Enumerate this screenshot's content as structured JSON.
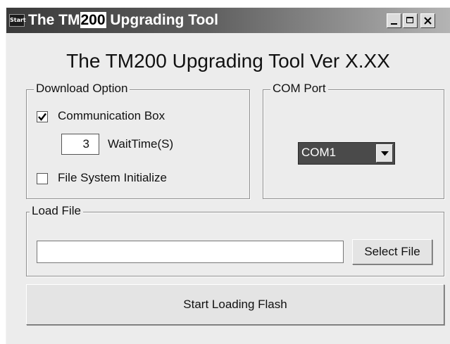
{
  "window": {
    "title_prefix": "The TM",
    "title_highlight": "200",
    "title_suffix": " Upgrading Tool",
    "icon": "Start"
  },
  "heading": "The TM200 Upgrading Tool Ver X.XX",
  "download_option": {
    "label": "Download Option",
    "communication_box": {
      "label": "Communication Box",
      "checked": true
    },
    "wait_time": {
      "value": "3",
      "label": "WaitTime(S)"
    },
    "file_system_initialize": {
      "label": "File System Initialize",
      "checked": false
    }
  },
  "com_port": {
    "label": "COM Port",
    "selected": "COM1"
  },
  "load_file": {
    "label": "Load File",
    "path_value": "",
    "select_button": "Select File"
  },
  "start_button": "Start Loading Flash"
}
